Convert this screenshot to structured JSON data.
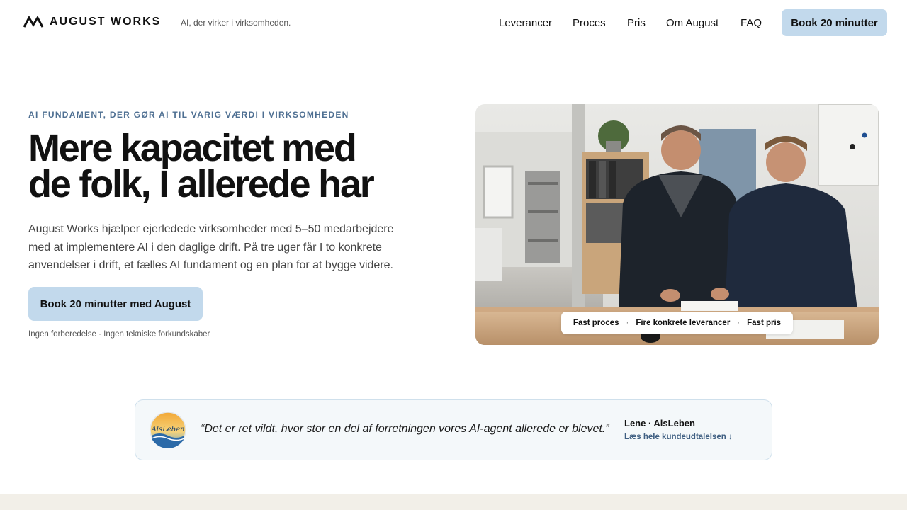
{
  "header": {
    "brand": "AUGUST WORKS",
    "tagline": "AI, der virker i virksomheden.",
    "nav": [
      "Leverancer",
      "Proces",
      "Pris",
      "Om August",
      "FAQ"
    ],
    "cta": "Book 20 minutter"
  },
  "hero": {
    "eyebrow": "AI FUNDAMENT, DER GØR AI TIL VARIG VÆRDI I VIRKSOMHEDEN",
    "headline_line1": "Mere kapacitet med",
    "headline_line2": "de folk, I allerede har",
    "body": "August Works hjælper ejerledede virksomheder med 5–50 medarbejdere med at implementere AI i den daglige drift. På tre uger får I to konkrete anvendelser i drift, et fælles AI fundament og en plan for at bygge videre.",
    "cta": "Book 20 minutter med August",
    "note": "Ingen forberedelse · Ingen tekniske forkundskaber",
    "pills": [
      "Fast proces",
      "Fire konkrete leverancer",
      "Fast pris"
    ],
    "pill_separator": "·"
  },
  "testimonial": {
    "logo_text": "AlsLeben",
    "quote": "“Det er ret vildt, hvor stor en del af forretningen vores AI-agent allerede er blevet.”",
    "author": "Lene · AlsLeben",
    "link": "Læs hele kundeudtalelsen ↓"
  },
  "colors": {
    "accent": "#c2d9ec",
    "eyebrow": "#4e6f92",
    "link": "#3f5f82",
    "band": "#f2efe8"
  }
}
